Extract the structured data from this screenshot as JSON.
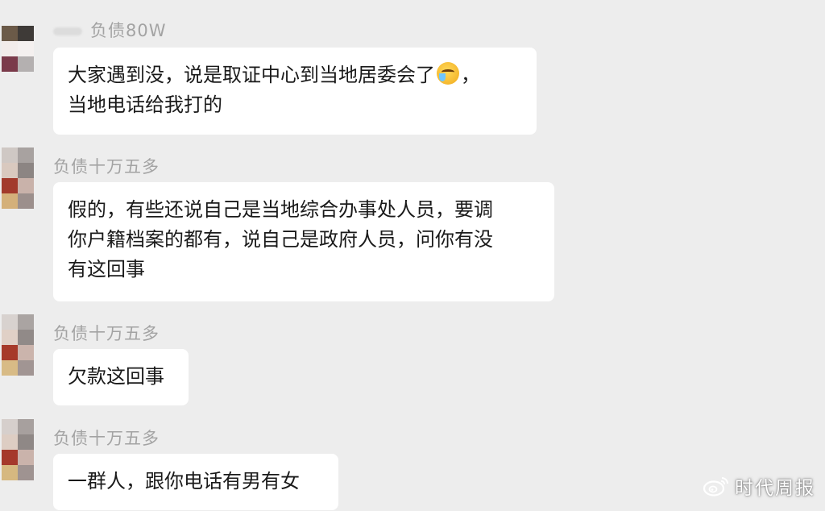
{
  "messages": [
    {
      "sender": "负债80W",
      "lines": [
        "大家遇到没，说是取证中心到当地居委会了",
        "，",
        "当地电话给我打的"
      ],
      "emoji": "crying-laughing-face"
    },
    {
      "sender": "负债十万五多",
      "lines": [
        "假的，有些还说自己是当地综合办事处人员，要调",
        "你户籍档案的都有，说自己是政府人员，问你有没",
        "有这回事"
      ]
    },
    {
      "sender": "负债十万五多",
      "lines": [
        "欠款这回事"
      ]
    },
    {
      "sender": "负债十万五多",
      "lines": [
        "一群人，跟你电话有男有女"
      ]
    }
  ],
  "watermark": {
    "text": "时代周报",
    "logo": "weibo-logo-icon"
  },
  "colors": {
    "background": "#ededed",
    "bubble": "#ffffff",
    "sender_text": "#a3a3a3",
    "message_text": "#1a1a1a"
  }
}
